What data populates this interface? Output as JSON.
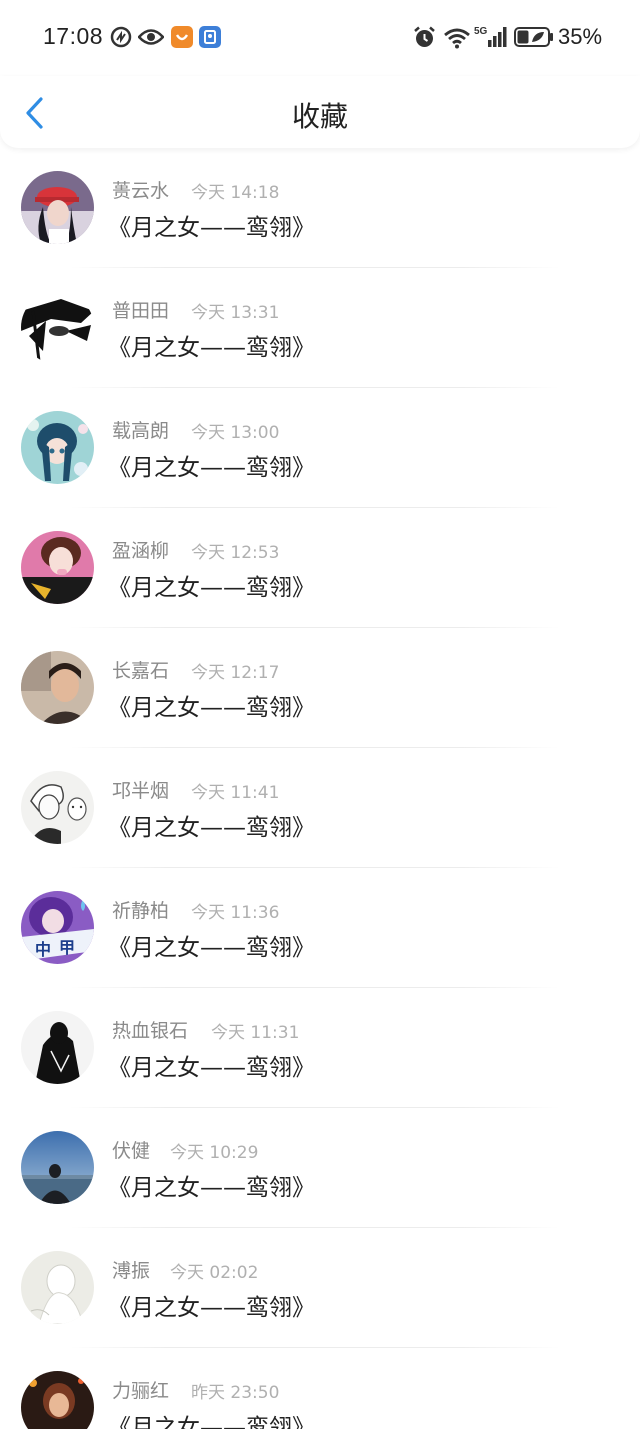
{
  "status_bar": {
    "time": "17:08",
    "battery": "35%",
    "network": "5G"
  },
  "header": {
    "title": "收藏"
  },
  "colors": {
    "accent": "#2f8de4",
    "name_gray": "#8a8a8a",
    "time_gray": "#b0b0b0"
  },
  "items": [
    {
      "name": "蒉云水",
      "time": "今天 14:18",
      "content": "《月之女——鸾翎》"
    },
    {
      "name": "普田田",
      "time": "今天 13:31",
      "content": "《月之女——鸾翎》"
    },
    {
      "name": "载高朗",
      "time": "今天 13:00",
      "content": "《月之女——鸾翎》"
    },
    {
      "name": "盈涵柳",
      "time": "今天 12:53",
      "content": "《月之女——鸾翎》"
    },
    {
      "name": "长嘉石",
      "time": "今天 12:17",
      "content": "《月之女——鸾翎》"
    },
    {
      "name": "邛半烟",
      "time": "今天 11:41",
      "content": "《月之女——鸾翎》"
    },
    {
      "name": "祈静柏",
      "time": "今天 11:36",
      "content": "《月之女——鸾翎》"
    },
    {
      "name": "热血银石",
      "time": "今天 11:31",
      "content": "《月之女——鸾翎》"
    },
    {
      "name": "伏健",
      "time": "今天 10:29",
      "content": "《月之女——鸾翎》"
    },
    {
      "name": "溥振",
      "time": "今天 02:02",
      "content": "《月之女——鸾翎》"
    },
    {
      "name": "力骊红",
      "time": "昨天 23:50",
      "content": "《月之女——鸾翎》"
    }
  ]
}
